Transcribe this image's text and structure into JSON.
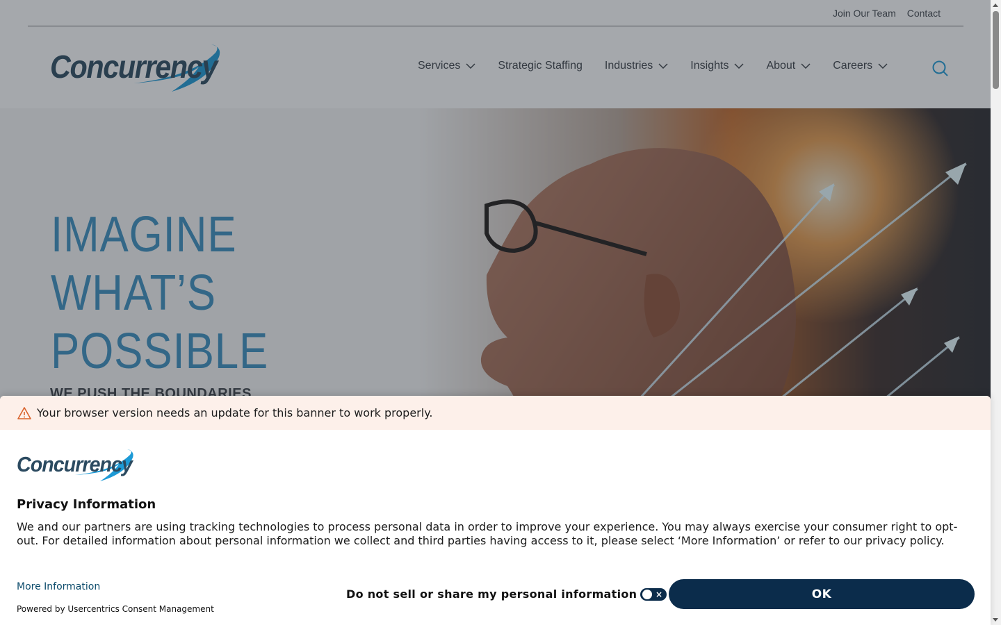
{
  "topbar": {
    "links": [
      "Join Our Team",
      "Contact"
    ]
  },
  "brand": {
    "logo_text": "Concurrency",
    "primary": "#2b4a60",
    "accent": "#1d9ad6"
  },
  "nav": {
    "items": [
      {
        "label": "Services",
        "has_dropdown": true
      },
      {
        "label": "Strategic Staffing",
        "has_dropdown": false
      },
      {
        "label": "Industries",
        "has_dropdown": true
      },
      {
        "label": "Insights",
        "has_dropdown": true
      },
      {
        "label": "About",
        "has_dropdown": true
      },
      {
        "label": "Careers",
        "has_dropdown": true
      }
    ],
    "search_icon": "search-icon"
  },
  "hero": {
    "title_lines": [
      "IMAGINE",
      "WHAT’S",
      "POSSIBLE"
    ],
    "subtitle": "WE PUSH THE BOUNDARIES"
  },
  "consent": {
    "warning": "Your browser version needs an update for this banner to work properly.",
    "logo_text": "Concurrency",
    "title": "Privacy Information",
    "body": "We and our partners are using tracking technologies to process personal data in order to improve your experience. You may always exercise your consumer right to opt-out. For detailed information about personal information we collect and third parties having access to it, please select ‘More Information’ or refer to our privacy policy.",
    "more_info": "More Information",
    "powered_by": "Powered by Usercentrics Consent Management",
    "do_not_sell": "Do not sell or share my personal information",
    "toggle_mark": "×",
    "ok": "OK"
  }
}
